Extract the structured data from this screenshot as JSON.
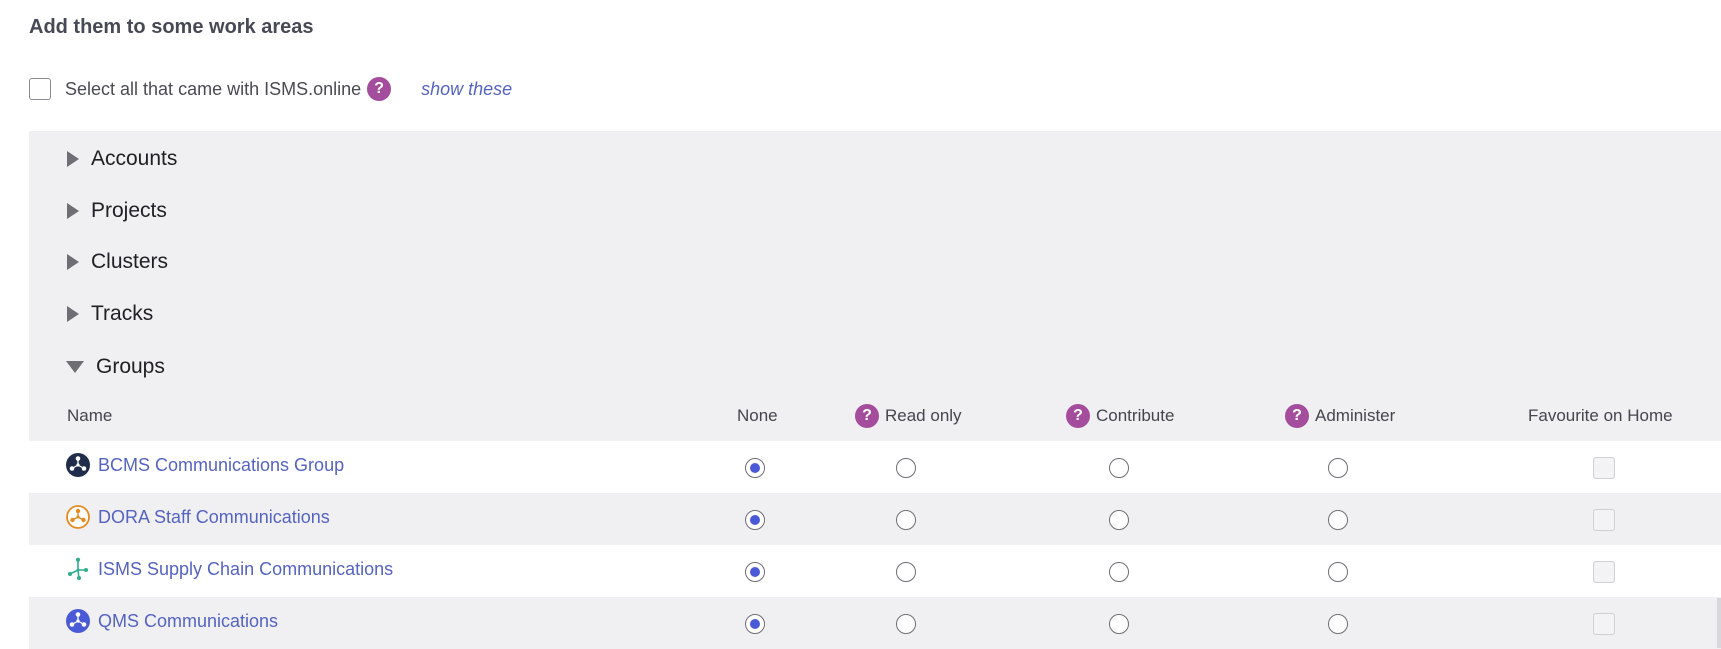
{
  "heading": "Add them to some work areas",
  "select_all": {
    "label": "Select all that came with ISMS.online",
    "help": "?",
    "link": "show these"
  },
  "sections": [
    {
      "label": "Accounts",
      "expanded": false
    },
    {
      "label": "Projects",
      "expanded": false
    },
    {
      "label": "Clusters",
      "expanded": false
    },
    {
      "label": "Tracks",
      "expanded": false
    },
    {
      "label": "Groups",
      "expanded": true
    }
  ],
  "columns": {
    "name": "Name",
    "none": "None",
    "read_only": "Read only",
    "contribute": "Contribute",
    "administer": "Administer",
    "favourite": "Favourite on Home",
    "help": "?"
  },
  "groups": [
    {
      "name": "BCMS Communications Group",
      "icon": "group-network-icon",
      "icon_color": "#1f2d4a",
      "permission": "None",
      "favourite": false
    },
    {
      "name": "DORA Staff Communications",
      "icon": "group-network-icon",
      "icon_color": "#e58a1f",
      "permission": "None",
      "favourite": false
    },
    {
      "name": "ISMS Supply Chain Communications",
      "icon": "branch-network-icon",
      "icon_color": "#2fae8f",
      "permission": "None",
      "favourite": false
    },
    {
      "name": "QMS Communications",
      "icon": "group-network-icon",
      "icon_color": "#4a5ad6",
      "permission": "None",
      "favourite": false
    }
  ],
  "colors": {
    "accent": "#4a5ad6",
    "link": "#5563c1",
    "help": "#a34d9c",
    "panel": "#f0f0f2"
  }
}
